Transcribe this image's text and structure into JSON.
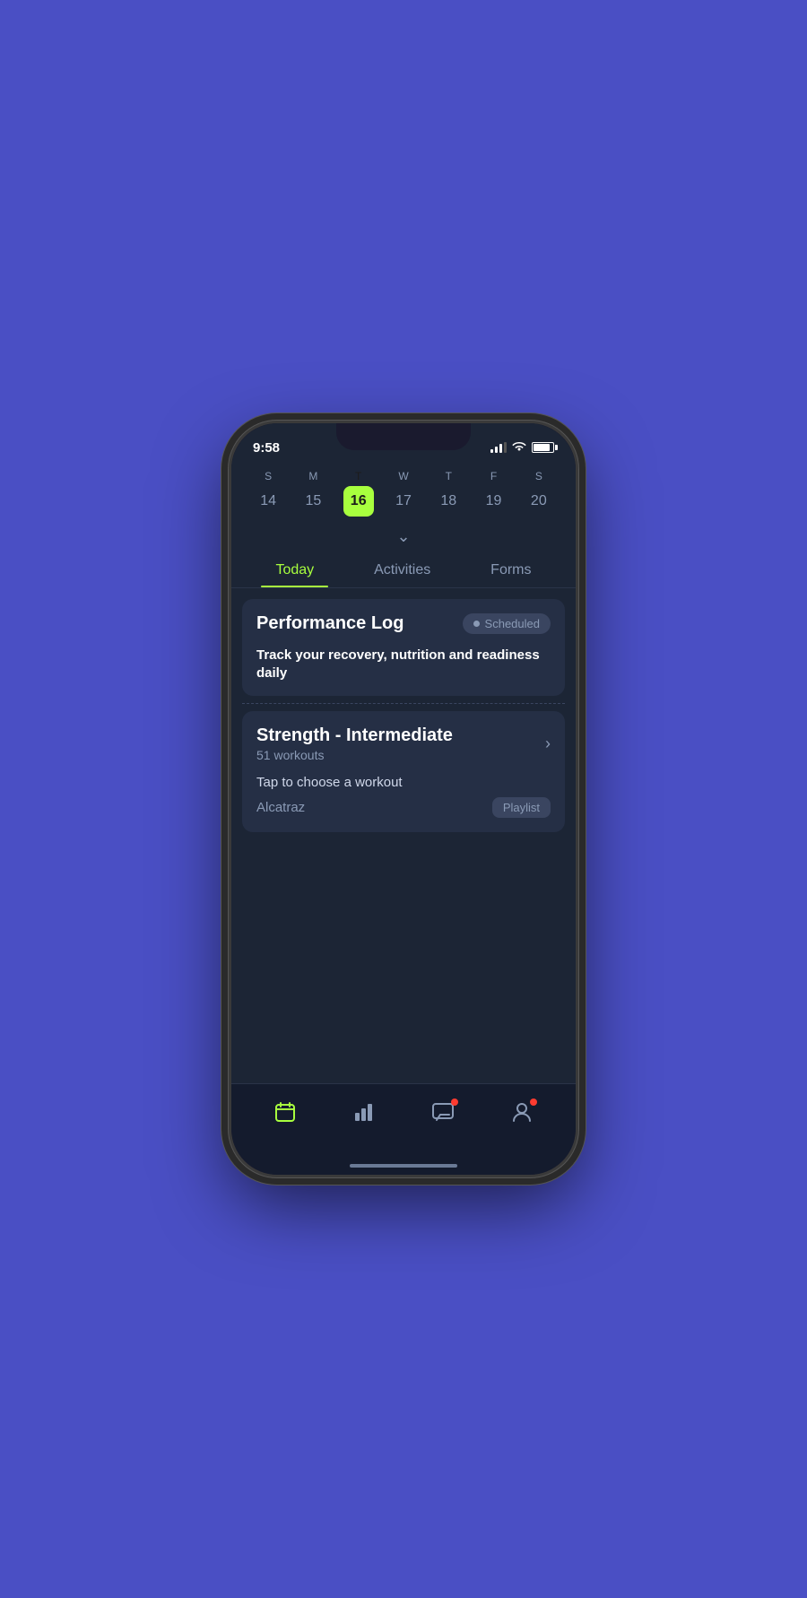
{
  "statusBar": {
    "time": "9:58",
    "batteryPercent": 85
  },
  "calendar": {
    "days": [
      {
        "letter": "S",
        "num": "14",
        "active": false
      },
      {
        "letter": "M",
        "num": "15",
        "active": false
      },
      {
        "letter": "T",
        "num": "16",
        "active": true
      },
      {
        "letter": "W",
        "num": "17",
        "active": false
      },
      {
        "letter": "T",
        "num": "18",
        "active": false
      },
      {
        "letter": "F",
        "num": "19",
        "active": false
      },
      {
        "letter": "S",
        "num": "20",
        "active": false
      }
    ]
  },
  "tabs": [
    {
      "label": "Today",
      "active": true
    },
    {
      "label": "Activities",
      "active": false
    },
    {
      "label": "Forms",
      "active": false
    }
  ],
  "performanceLog": {
    "title": "Performance Log",
    "badgeText": "Scheduled",
    "description": "Track your recovery, nutrition and readiness daily"
  },
  "strengthCard": {
    "title": "Strength - Intermediate",
    "subtitle": "51 workouts",
    "tapText": "Tap to choose a workout",
    "playlistName": "Alcatraz",
    "playlistBadge": "Playlist"
  },
  "bottomNav": {
    "items": [
      {
        "name": "calendar",
        "active": true,
        "hasDot": false
      },
      {
        "name": "chart",
        "active": false,
        "hasDot": false
      },
      {
        "name": "message",
        "active": false,
        "hasDot": true
      },
      {
        "name": "profile",
        "active": false,
        "hasDot": true
      }
    ]
  }
}
